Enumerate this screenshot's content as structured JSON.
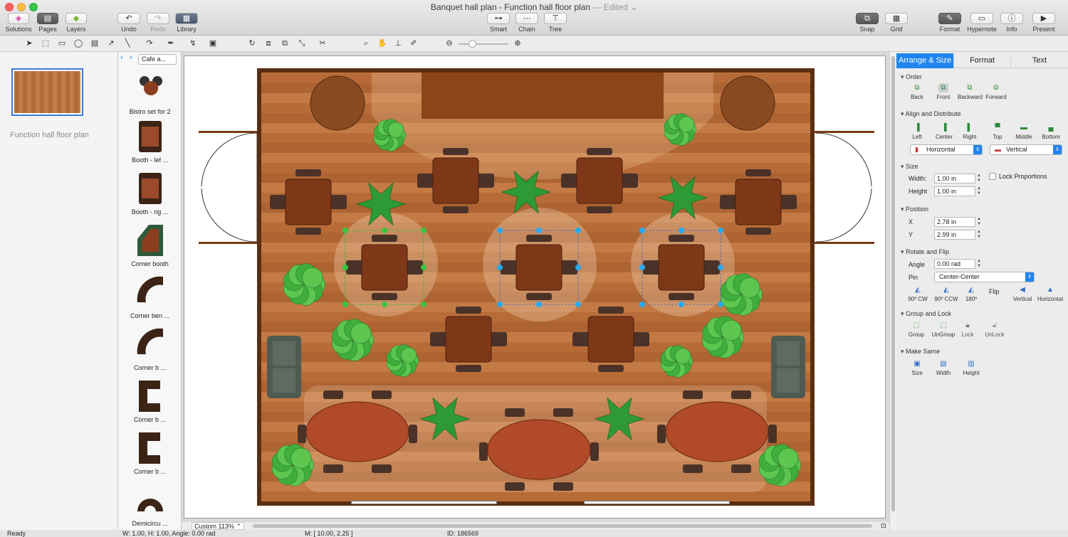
{
  "window": {
    "title": "Banquet hall plan - Function hall floor plan",
    "edited": "— Edited ⌄"
  },
  "toolbar": {
    "solutions": "Solutions",
    "pages": "Pages",
    "layers": "Layers",
    "undo": "Undo",
    "redo": "Redo",
    "library": "Library",
    "smart": "Smart",
    "chain": "Chain",
    "tree": "Tree",
    "snap": "Snap",
    "grid": "Grid",
    "format": "Format",
    "hypernote": "Hypernote",
    "info": "Info",
    "present": "Present"
  },
  "pages_panel": {
    "page_name": "Function hall floor plan"
  },
  "library": {
    "selected": "Cafe a...",
    "items": [
      {
        "label": "Bistro set for 2"
      },
      {
        "label": "Booth - lef ..."
      },
      {
        "label": "Booth - rig ..."
      },
      {
        "label": "Corner booth"
      },
      {
        "label": "Corner ben ..."
      },
      {
        "label": "Corner b ..."
      },
      {
        "label": "Corner b ..."
      },
      {
        "label": "Corner b ..."
      },
      {
        "label": "Demicircu ..."
      }
    ]
  },
  "canvas": {
    "zoom": "Custom 113%"
  },
  "status": {
    "ready": "Ready",
    "size": "W: 1.00,  H: 1.00,  Angle: 0.00 rad",
    "mouse": "M: [ 10.00, 2.25 ]",
    "id": "ID: 186569"
  },
  "inspector": {
    "tabs": [
      "Arrange & Size",
      "Format",
      "Text"
    ],
    "order": {
      "title": "Order",
      "back": "Back",
      "front": "Front",
      "backward": "Backward",
      "forward": "Forward"
    },
    "align": {
      "title": "Align and Distribute",
      "left": "Left",
      "center": "Center",
      "right": "Right",
      "top": "Top",
      "middle": "Middle",
      "bottom": "Bottom",
      "horizontal": "Horizontal",
      "vertical": "Vertical"
    },
    "size": {
      "title": "Size",
      "width_label": "Width:",
      "width": "1.00 in",
      "height_label": "Height",
      "height": "1.00 in",
      "lock": "Lock Proportions"
    },
    "position": {
      "title": "Position",
      "x_label": "X",
      "x": "2.78 in",
      "y_label": "Y",
      "y": "2.99 in"
    },
    "rotate": {
      "title": "Rotate and Flip",
      "angle_label": "Angle",
      "angle": "0.00 rad",
      "pin_label": "Pin",
      "pin": "Center-Center",
      "cw": "90º CW",
      "ccw": "90º CCW",
      "r180": "180º",
      "flip": "Flip",
      "vertical": "Vertical",
      "horizontal": "Horizontal"
    },
    "group": {
      "title": "Group and Lock",
      "group": "Group",
      "ungroup": "UnGroup",
      "lock": "Lock",
      "unlock": "UnLock"
    },
    "same": {
      "title": "Make Same",
      "size": "Size",
      "width": "Width",
      "height": "Height"
    }
  }
}
